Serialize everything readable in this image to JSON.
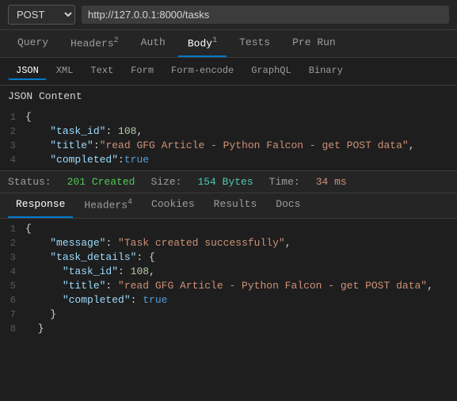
{
  "topbar": {
    "method": "POST",
    "url": "http://127.0.0.1:8000/tasks"
  },
  "navtabs": [
    {
      "label": "Query",
      "badge": "",
      "active": false
    },
    {
      "label": "Headers",
      "badge": "2",
      "active": false
    },
    {
      "label": "Auth",
      "badge": "",
      "active": false
    },
    {
      "label": "Body",
      "badge": "1",
      "active": true
    },
    {
      "label": "Tests",
      "badge": "",
      "active": false
    },
    {
      "label": "Pre Run",
      "badge": "",
      "active": false
    }
  ],
  "subtabs": [
    {
      "label": "JSON",
      "active": true
    },
    {
      "label": "XML",
      "active": false
    },
    {
      "label": "Text",
      "active": false
    },
    {
      "label": "Form",
      "active": false
    },
    {
      "label": "Form-encode",
      "active": false
    },
    {
      "label": "GraphQL",
      "active": false
    },
    {
      "label": "Binary",
      "active": false
    }
  ],
  "body_section_label": "JSON Content",
  "body_lines": [
    {
      "num": "1",
      "content": "{"
    },
    {
      "num": "2",
      "content": "  \"task_id\": 108,"
    },
    {
      "num": "3",
      "content": "  \"title\":\"read GFG Article - Python Falcon - get POST data\","
    },
    {
      "num": "4",
      "content": "  \"completed\":true"
    }
  ],
  "status": {
    "label": "Status:",
    "code": "201 Created",
    "size_label": "Size:",
    "size_val": "154 Bytes",
    "time_label": "Time:",
    "time_val": "34 ms"
  },
  "resptabs": [
    {
      "label": "Response",
      "active": true
    },
    {
      "label": "Headers",
      "badge": "4",
      "active": false
    },
    {
      "label": "Cookies",
      "active": false
    },
    {
      "label": "Results",
      "active": false
    },
    {
      "label": "Docs",
      "active": false
    }
  ],
  "response_lines": [
    {
      "num": "1",
      "content": "  {"
    },
    {
      "num": "2",
      "content": "    \"message\": \"Task created successfully\","
    },
    {
      "num": "3",
      "content": "    \"task_details\": {"
    },
    {
      "num": "4",
      "content": "      \"task_id\": 108,"
    },
    {
      "num": "5",
      "content": "      \"title\": \"read GFG Article - Python Falcon - get POST data\","
    },
    {
      "num": "6",
      "content": "      \"completed\": true"
    },
    {
      "num": "7",
      "content": "    }"
    },
    {
      "num": "8",
      "content": "  }"
    }
  ]
}
